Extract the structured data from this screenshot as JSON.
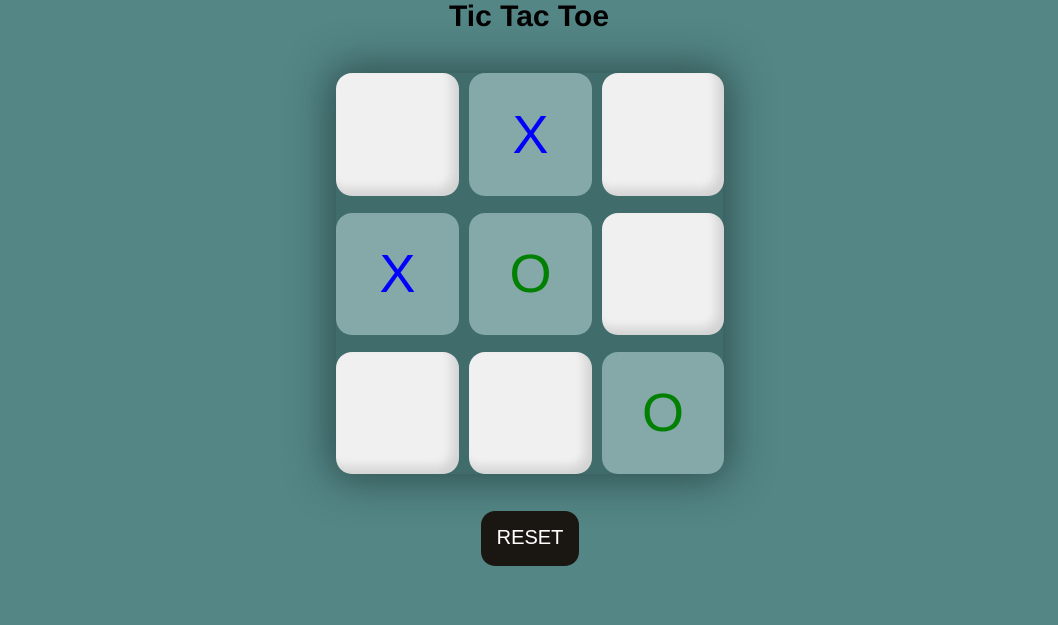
{
  "title": "Tic Tac Toe",
  "board": {
    "cells": [
      "",
      "X",
      "",
      "X",
      "O",
      "",
      "",
      "",
      "O"
    ]
  },
  "colors": {
    "background": "#548686",
    "empty_cell": "#f0f0f0",
    "filled_cell": "#85a8a8",
    "x_mark": "#0000ff",
    "o_mark": "#008000",
    "reset_button": "#1a1712"
  },
  "reset_label": "RESET"
}
